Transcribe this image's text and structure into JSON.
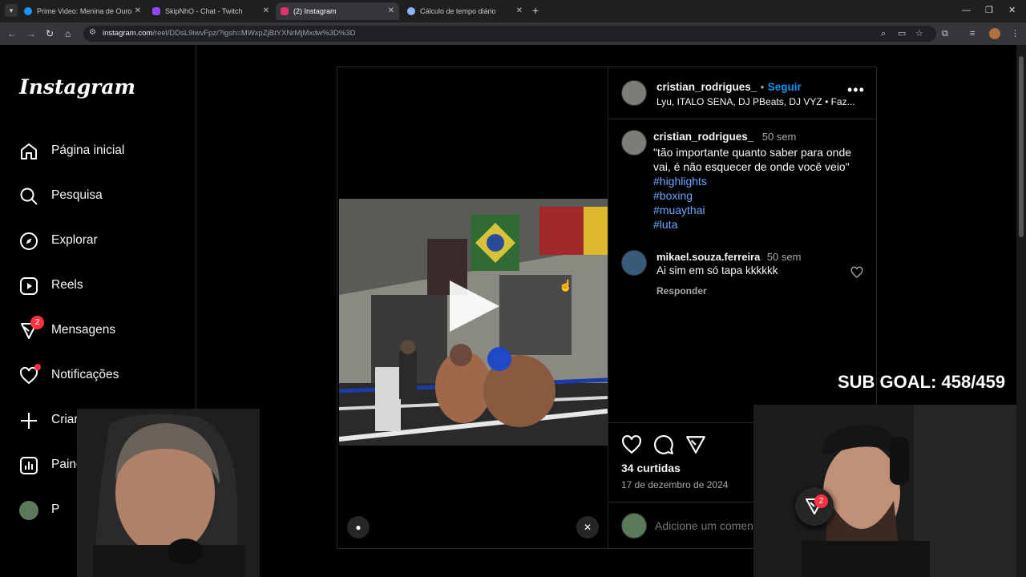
{
  "browser": {
    "tabs": [
      {
        "title": "Prime Video: Menina de Ouro",
        "favicon_color": "#1a98ff"
      },
      {
        "title": "SkipNhO - Chat - Twitch",
        "favicon_color": "#9146ff"
      },
      {
        "title": "(2) Instagram",
        "favicon_color": "#e1306c"
      },
      {
        "title": "Cálculo de tempo diário",
        "favicon_color": "#8ab4f8"
      }
    ],
    "url_host": "instagram.com",
    "url_path": "/reel/DDsL9iwvFpz/?igsh=MWxpZjBtYXNrMjMxdw%3D%3D"
  },
  "sidebar": {
    "logo": "Instagram",
    "items": [
      {
        "label": "Página inicial",
        "icon": "home-icon"
      },
      {
        "label": "Pesquisa",
        "icon": "search-icon"
      },
      {
        "label": "Explorar",
        "icon": "compass-icon"
      },
      {
        "label": "Reels",
        "icon": "reels-icon"
      },
      {
        "label": "Mensagens",
        "icon": "messenger-icon",
        "badge": "2"
      },
      {
        "label": "Notificações",
        "icon": "heart-icon"
      },
      {
        "label": "Criar",
        "icon": "plus-icon"
      },
      {
        "label": "Painel",
        "icon": "dashboard-icon"
      },
      {
        "label": "P",
        "icon": "profile-avatar"
      }
    ]
  },
  "post": {
    "author": "cristian_rodrigues_",
    "separator": "•",
    "follow": "Seguir",
    "audio": "Lyu, ITALO SENA, DJ PBeats, DJ VYZ • Faz...",
    "caption": {
      "user": "cristian_rodrigues_",
      "time": "50 sem",
      "text": "\"tão importante quanto saber para onde vai, é não esquecer de onde você veio\"",
      "hashtags": [
        "#highlights",
        "#boxing",
        "#muaythai",
        "#luta"
      ]
    },
    "comments": [
      {
        "user": "mikael.souza.ferreira",
        "time": "50 sem",
        "text": "Ai sim em só tapa kkkkkk",
        "reply": "Responder"
      }
    ],
    "likes": "34 curtidas",
    "date": "17 de dezembro de 2024",
    "comment_placeholder": "Adicione um comentário..."
  },
  "stream": {
    "sub_goal": "SUB GOAL: 458/459",
    "fab_badge": "2"
  },
  "colors": {
    "accent_link": "#6aa6ff",
    "badge": "#ff3040",
    "follow": "#0095f6"
  }
}
